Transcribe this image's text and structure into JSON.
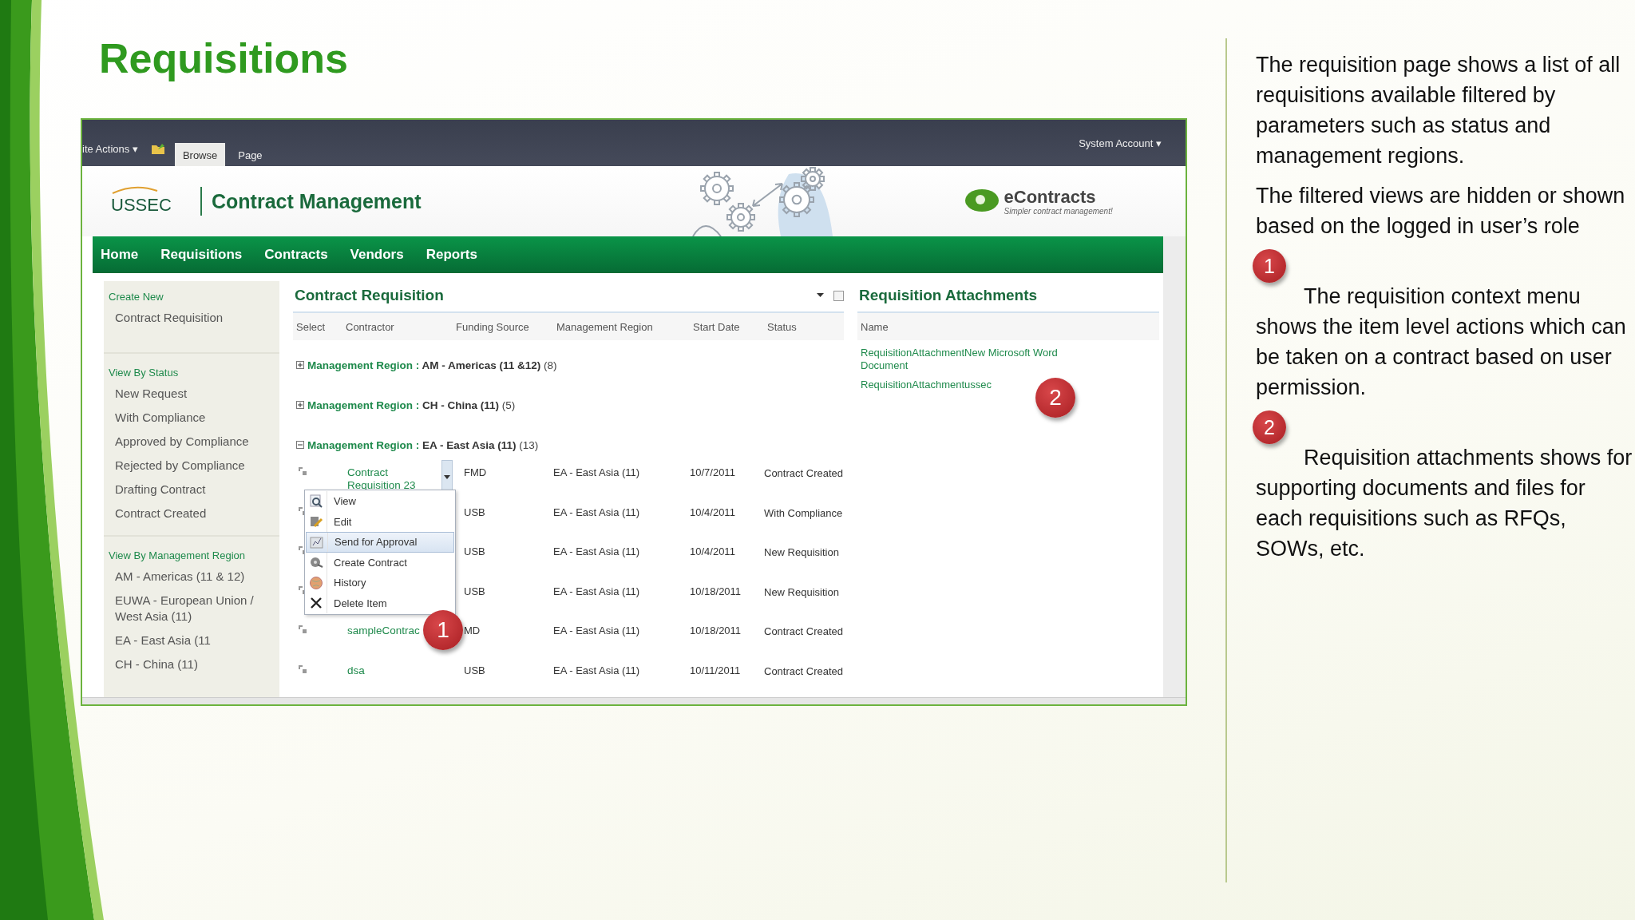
{
  "slide": {
    "title": "Requisitions"
  },
  "screenshot": {
    "top_bar": {
      "site_actions": "ite Actions ▾",
      "tabs": [
        {
          "label": "Browse",
          "selected": true
        },
        {
          "label": "Page",
          "selected": false
        }
      ],
      "account": "System Account ▾"
    },
    "header": {
      "logo_text": "USSEC",
      "site_title": "Contract Management",
      "brand": "eContracts",
      "tagline": "Simpler contract management!"
    },
    "nav": [
      "Home",
      "Requisitions",
      "Contracts",
      "Vendors",
      "Reports"
    ],
    "sidebar": [
      {
        "heading": "Create New",
        "items": [
          "Contract Requisition"
        ]
      },
      {
        "heading": "View By Status",
        "items": [
          "New Request",
          "With Compliance",
          "Approved by Compliance",
          "Rejected by Compliance",
          "Drafting Contract",
          "Contract Created"
        ]
      },
      {
        "heading": "View By Management Region",
        "items": [
          "AM - Americas (11 & 12)",
          "EUWA - European Union / West Asia (11)",
          "EA - East Asia (11",
          "CH - China (11)"
        ]
      }
    ],
    "list": {
      "title": "Contract Requisition",
      "columns": [
        "Select",
        "Contractor",
        "Funding Source",
        "Management Region",
        "Start Date",
        "Status"
      ],
      "groups": [
        {
          "field": "Management Region :",
          "value": "AM - Americas (11 &12)",
          "count": "(8)",
          "expanded": false
        },
        {
          "field": "Management Region :",
          "value": "CH - China (11)",
          "count": "(5)",
          "expanded": false
        },
        {
          "field": "Management Region :",
          "value": "EA - East Asia (11)",
          "count": "(13)",
          "expanded": true
        }
      ],
      "rows": [
        {
          "contractor": "Contract Requisition 23",
          "menu_open": true,
          "funding": "FMD",
          "region": "EA - East Asia (11)",
          "date": "10/7/2011",
          "status": "Contract Created"
        },
        {
          "funding": "USB",
          "region": "EA - East Asia (11)",
          "date": "10/4/2011",
          "status": "With Compliance"
        },
        {
          "funding": "USB",
          "region": "EA - East Asia (11)",
          "date": "10/4/2011",
          "status": "New Requisition"
        },
        {
          "funding": "USB",
          "region": "EA - East Asia (11)",
          "date": "10/18/2011",
          "status": "New Requisition"
        },
        {
          "contractor": "sampleContrac",
          "funding": "MD",
          "region": "EA - East Asia (11)",
          "date": "10/18/2011",
          "status": "Contract Created"
        },
        {
          "contractor": "dsa",
          "funding": "USB",
          "region": "EA - East Asia (11)",
          "date": "10/11/2011",
          "status": "Contract Created"
        }
      ],
      "context_menu": [
        {
          "kind": "view",
          "label": "View",
          "selected": false
        },
        {
          "kind": "edit",
          "label": "Edit",
          "selected": false
        },
        {
          "kind": "approve",
          "label": "Send for Approval",
          "selected": true
        },
        {
          "kind": "create",
          "label": "Create Contract",
          "selected": false
        },
        {
          "kind": "history",
          "label": "History",
          "selected": false
        },
        {
          "kind": "delete",
          "label": "Delete Item",
          "selected": false
        }
      ]
    },
    "attachments": {
      "title": "Requisition Attachments",
      "column": "Name",
      "items": [
        "RequisitionAttachmentNew Microsoft Word Document",
        "RequisitionAttachmentussec"
      ]
    },
    "callouts": [
      "1",
      "2"
    ]
  },
  "notes": [
    {
      "text": "The requisition page shows a list of all requisitions available filtered by parameters such as status and management regions."
    },
    {
      "text": "The filtered views are hidden or shown based on the logged in user’s role"
    },
    {
      "badge": "1",
      "text": "The requisition context menu shows the item level actions which can be taken on a contract based on user permission."
    },
    {
      "badge": "2",
      "text": "Requisition attachments shows for supporting documents and files for each requisitions such as RFQs, SOWs, etc."
    }
  ]
}
